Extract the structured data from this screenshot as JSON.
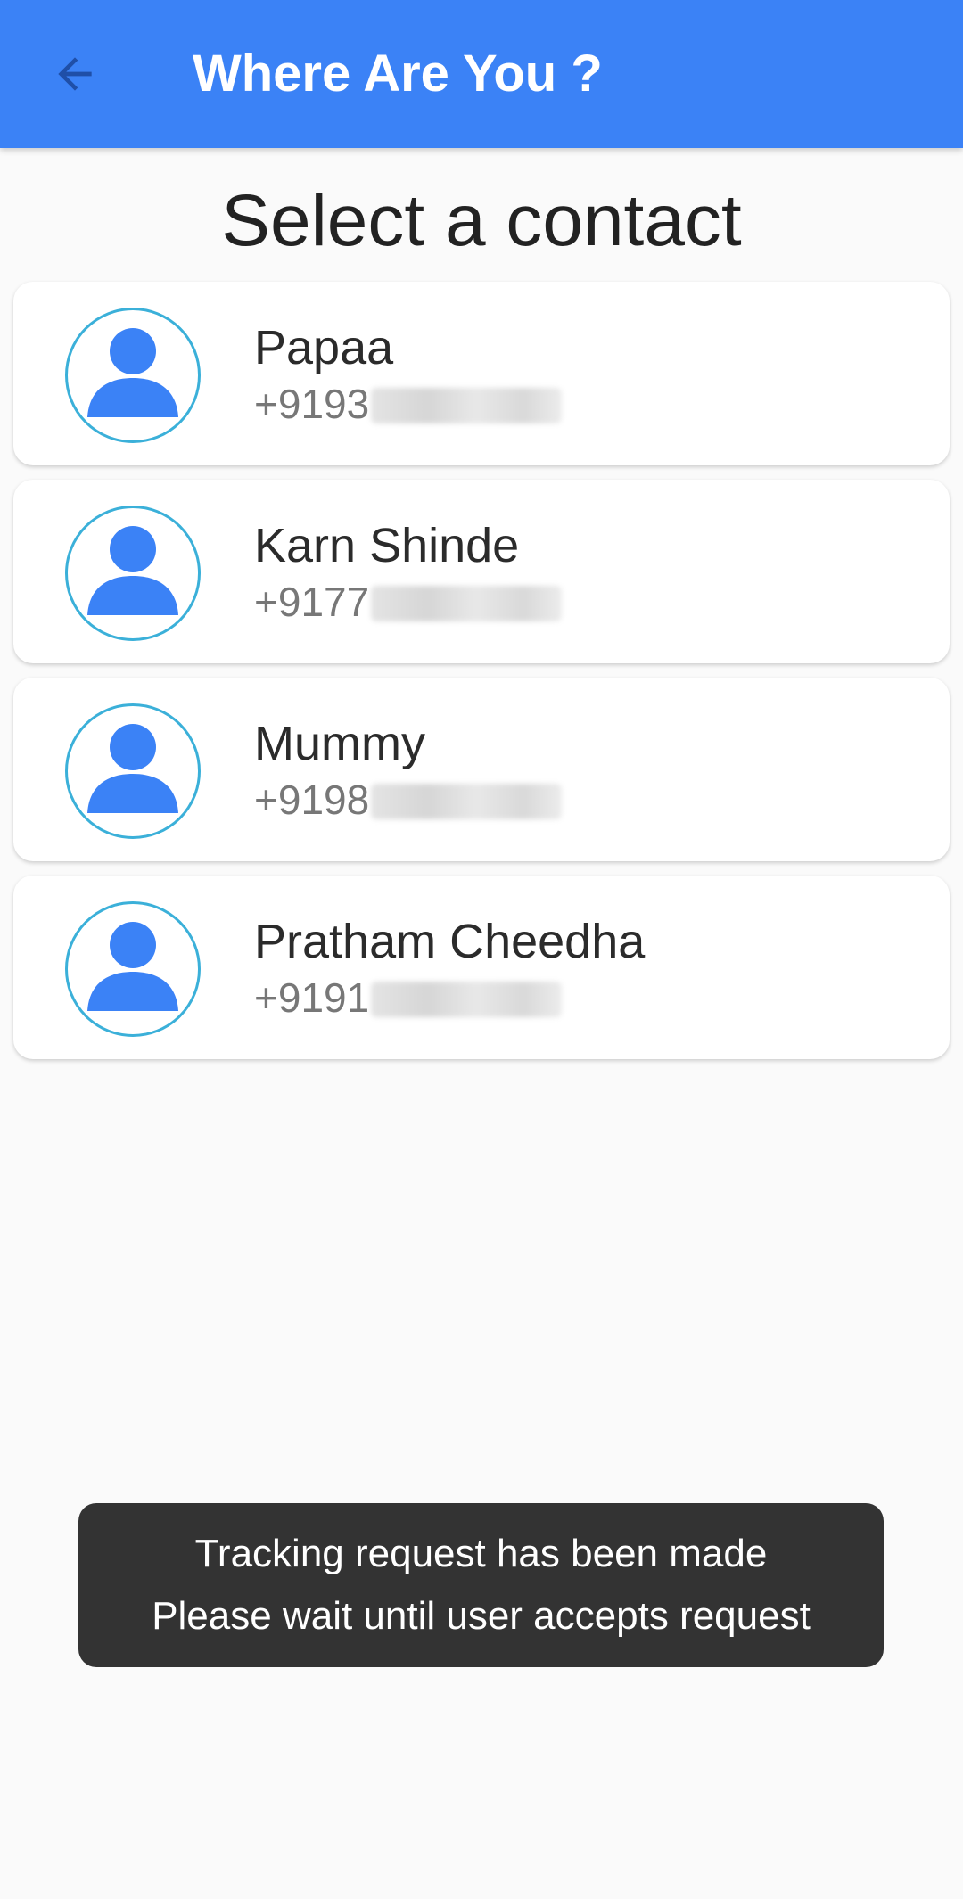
{
  "app_bar": {
    "title": "Where Are You ?",
    "back_icon": "arrow-back-icon",
    "background_color": "#3b82f6",
    "icon_color": "#1f4fa8"
  },
  "heading": "Select a contact",
  "contacts": [
    {
      "name": "Papaa",
      "phone_visible": "+9193",
      "avatar_icon": "person-icon"
    },
    {
      "name": "Karn Shinde",
      "phone_visible": "+9177",
      "avatar_icon": "person-icon"
    },
    {
      "name": "Mummy",
      "phone_visible": "+9198",
      "avatar_icon": "person-icon"
    },
    {
      "name": "Pratham Cheedha",
      "phone_visible": "+9191",
      "avatar_icon": "person-icon"
    }
  ],
  "toast": {
    "line1": "Tracking request has been made",
    "line2": "Please wait until user accepts request"
  },
  "colors": {
    "accent": "#3b82f6",
    "avatar_ring": "#3bb0d9",
    "toast_bg": "#333333",
    "page_bg": "#fafafa"
  }
}
